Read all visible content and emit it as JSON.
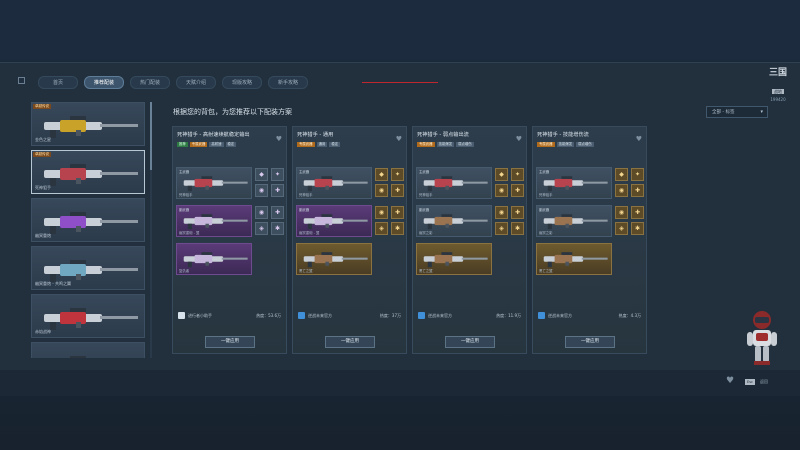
{
  "tabs": [
    {
      "label": "首页",
      "active": false
    },
    {
      "label": "推荐配装",
      "active": true
    },
    {
      "label": "热门配装",
      "active": false
    },
    {
      "label": "天赋介绍",
      "active": false
    },
    {
      "label": "现版攻略",
      "active": false
    },
    {
      "label": "新手攻略",
      "active": false
    }
  ],
  "logo": {
    "main": "三国",
    "sub": "战地",
    "num": "199420"
  },
  "heading": "根据您的背包，为您推荐以下配装方案",
  "filter": {
    "label": "全部 - 标签"
  },
  "weapons": [
    {
      "name": "金色之星",
      "tag": "卓越传说",
      "color": "#c9a22a",
      "selected": false
    },
    {
      "name": "死神狙手",
      "tag": "卓越传说",
      "color": "#b7434f",
      "selected": true
    },
    {
      "name": "幽冥重炮",
      "tag": "",
      "color": "#8f4fc9",
      "selected": false
    },
    {
      "name": "幽冥重炮 - 共鸣之翼",
      "tag": "",
      "color": "#6fa8c0",
      "selected": false
    },
    {
      "name": "赤焰战神",
      "tag": "",
      "color": "#c0343d",
      "selected": false
    },
    {
      "name": "",
      "tag": "",
      "color": "#c99a3a",
      "selected": false
    }
  ],
  "cards": [
    {
      "title": "死神猎手 - 高射速续航稳定输出",
      "badges": [
        {
          "text": "推荐",
          "style": "green"
        },
        {
          "text": "专属武器",
          "style": "orange"
        },
        {
          "text": "高射速",
          "style": "plain"
        },
        {
          "text": "稳定",
          "style": "plain"
        }
      ],
      "slots": [
        {
          "label": "主武器",
          "name": "死神狙手",
          "style": "plain"
        },
        {
          "label": "副武器",
          "name": "幽冥重炮 - 翼",
          "style": "purple"
        },
        {
          "label": "",
          "name": "复仇者",
          "style": "purple"
        }
      ],
      "mod_style": "purple",
      "author": "进行者小助手",
      "avatar": "white",
      "heat_label": "热度：",
      "heat": "53.6万",
      "button": "一键应用"
    },
    {
      "title": "死神猎手 - 通用",
      "badges": [
        {
          "text": "专属武器",
          "style": "orange"
        },
        {
          "text": "通用",
          "style": "plain"
        },
        {
          "text": "稳定",
          "style": "plain"
        }
      ],
      "slots": [
        {
          "label": "主武器",
          "name": "死神狙手",
          "style": "plain"
        },
        {
          "label": "副武器",
          "name": "幽冥重炮 - 翼",
          "style": "purple"
        },
        {
          "label": "",
          "name": "黑亡之翼",
          "style": "gold"
        }
      ],
      "mod_style": "gold",
      "author": "逆战未来官方",
      "avatar": "blue",
      "heat_label": "热度：",
      "heat": "37万",
      "button": "一键应用"
    },
    {
      "title": "死神猎手 - 弱点输出流",
      "badges": [
        {
          "text": "专属武器",
          "style": "orange"
        },
        {
          "text": "技能爆发",
          "style": "plain"
        },
        {
          "text": "弱点增伤",
          "style": "plain"
        }
      ],
      "slots": [
        {
          "label": "主武器",
          "name": "死神狙手",
          "style": "plain"
        },
        {
          "label": "副武器",
          "name": "幽冥之影",
          "style": "plain"
        },
        {
          "label": "",
          "name": "黑亡之翼",
          "style": "gold"
        }
      ],
      "mod_style": "gold",
      "author": "逆战未来官方",
      "avatar": "blue",
      "heat_label": "热度：",
      "heat": "11.9万",
      "button": "一键应用"
    },
    {
      "title": "死神猎手 - 技能增伤流",
      "badges": [
        {
          "text": "专属武器",
          "style": "orange"
        },
        {
          "text": "技能爆发",
          "style": "plain"
        },
        {
          "text": "弱点增伤",
          "style": "plain"
        }
      ],
      "slots": [
        {
          "label": "主武器",
          "name": "死神狙手",
          "style": "plain"
        },
        {
          "label": "副武器",
          "name": "幽冥之影",
          "style": "plain"
        },
        {
          "label": "",
          "name": "黑亡之翼",
          "style": "gold"
        }
      ],
      "mod_style": "gold",
      "author": "逆战未来官方",
      "avatar": "blue",
      "heat_label": "热度：",
      "heat": "4.3万",
      "button": "一键应用"
    }
  ],
  "bottom": {
    "key": "Esc",
    "back": "返回"
  },
  "colors": {
    "accent_red": "#c0262e",
    "panel": "#22303d",
    "card": "#2d3d4c"
  }
}
